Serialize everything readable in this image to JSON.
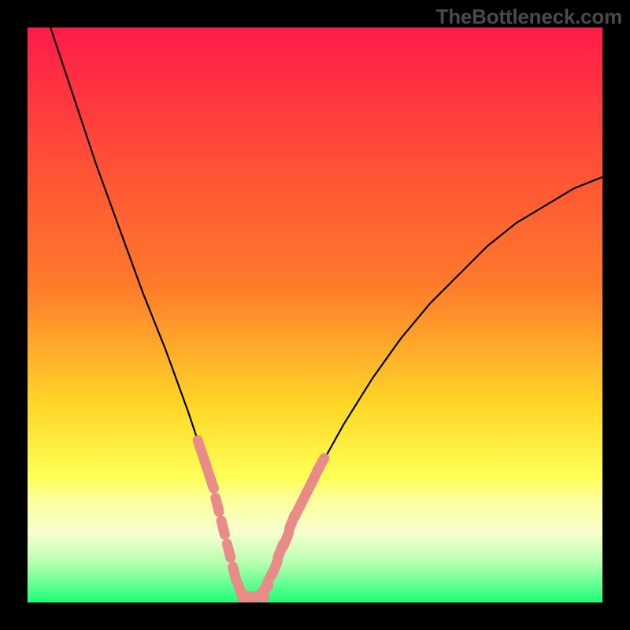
{
  "watermark": "TheBottleneck.com",
  "colors": {
    "frame": "#000000",
    "gradient_top": "#ff1b4a",
    "gradient_mid_upper": "#ff7b2b",
    "gradient_mid": "#ffd828",
    "gradient_low_band1": "#ffff9a",
    "gradient_low_band2": "#f6ffcf",
    "gradient_bottom": "#1cff78",
    "curve": "#000000",
    "marker_fill": "#e98b86",
    "marker_stroke": "#d47571"
  },
  "chart_data": {
    "type": "line",
    "title": "",
    "xlabel": "",
    "ylabel": "",
    "xlim": [
      0,
      100
    ],
    "ylim": [
      0,
      100
    ],
    "grid": false,
    "legend": false,
    "series": [
      {
        "name": "curve",
        "x": [
          4,
          8,
          12,
          16,
          20,
          24,
          28,
          30,
          32,
          34,
          35,
          36,
          37,
          38,
          39,
          40,
          41,
          42,
          44,
          46,
          50,
          55,
          60,
          65,
          70,
          75,
          80,
          85,
          90,
          95,
          100
        ],
        "y": [
          100,
          88,
          76,
          65,
          54,
          44,
          33,
          27,
          21,
          13,
          9,
          5,
          2,
          1,
          1,
          1,
          2,
          4,
          9,
          14,
          22,
          31,
          39,
          46,
          52,
          57,
          62,
          66,
          69,
          72,
          74
        ]
      }
    ],
    "markers": {
      "name": "pink-dots",
      "x": [
        30,
        31,
        32,
        33,
        34,
        35,
        36,
        37,
        38,
        39,
        40,
        41,
        42,
        43,
        44,
        45,
        46,
        47,
        48,
        49,
        50,
        51
      ],
      "y": [
        27,
        24,
        21,
        17,
        13,
        9,
        5,
        2,
        1,
        1,
        1,
        2,
        4,
        6,
        9,
        11,
        14,
        16,
        18,
        20,
        22,
        24
      ]
    }
  }
}
